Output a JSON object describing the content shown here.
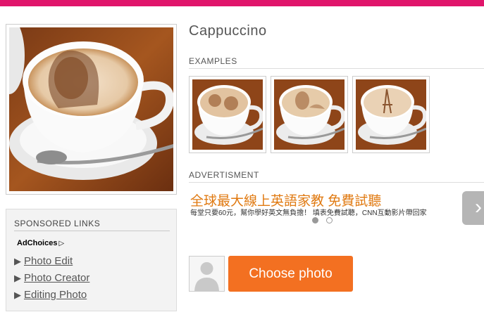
{
  "effect": {
    "title": "Cappuccino"
  },
  "sections": {
    "examples_label": "EXAMPLES",
    "ad_label": "ADVERTISMENT"
  },
  "sponsored": {
    "title": "SPONSORED LINKS",
    "adchoices": "AdChoices",
    "links": [
      {
        "label": "Photo Edit"
      },
      {
        "label": "Photo Creator"
      },
      {
        "label": "Editing Photo"
      }
    ]
  },
  "ad": {
    "headline": "全球最大線上英語家教 免費試聽",
    "subtext": "每堂只要60元，幫你學好英文無負擔！ 填表免費試聽，CNN互動影片帶回家",
    "next_glyph": "›"
  },
  "actions": {
    "choose_photo": "Choose photo"
  },
  "colors": {
    "brand": "#e0156b",
    "button": "#f37021",
    "ad_headline": "#e07a12"
  },
  "icons": {
    "avatar": "user-silhouette-icon",
    "ad_next": "chevron-right-icon"
  }
}
